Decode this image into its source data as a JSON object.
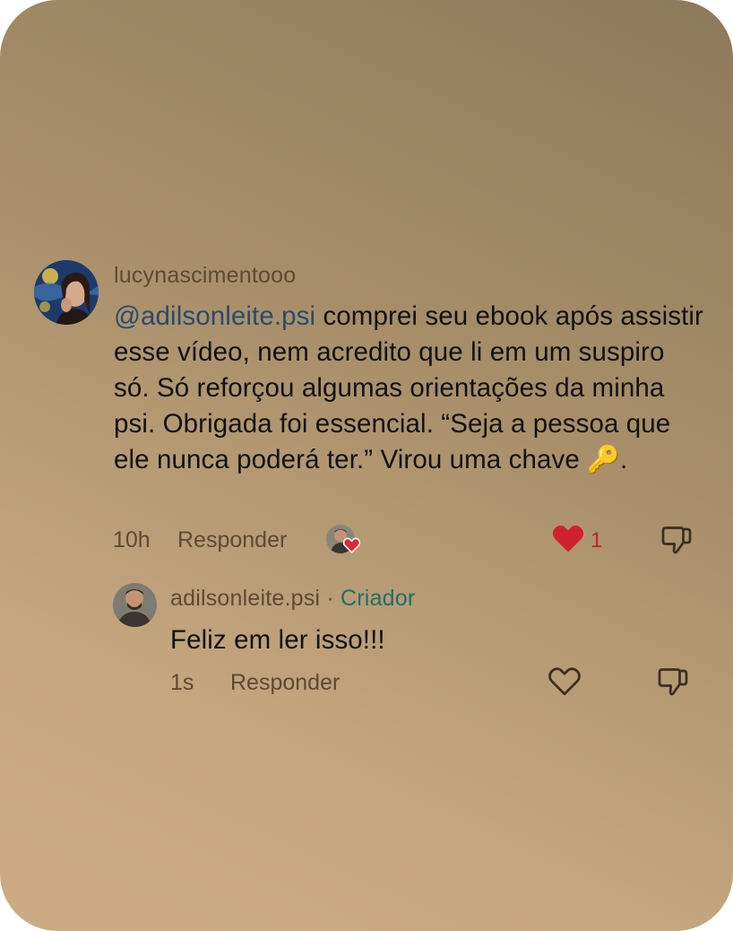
{
  "comment": {
    "username": "lucynascimentooo",
    "mention": "@adilsonleite.psi",
    "text": " comprei seu ebook após assistir esse vídeo, nem acredito que li em um suspiro só. Só reforçou algumas orientações da minha psi. Obrigada foi essencial. “Seja a pessoa que ele nunca poderá ter.” Virou uma chave ",
    "emoji": "🔑",
    "text_end": ".",
    "time": "10h",
    "reply_label": "Responder",
    "like_count": "1",
    "liked": true,
    "like_color": "#d0202e"
  },
  "reply": {
    "username": "adilsonleite.psi",
    "separator": " · ",
    "badge": "Criador",
    "text": "Feliz em ler isso!!!",
    "time": "1s",
    "reply_label": "Responder",
    "liked": false
  },
  "colors": {
    "creator_badge": "#1d6f66",
    "mention": "#2a4a6e"
  }
}
